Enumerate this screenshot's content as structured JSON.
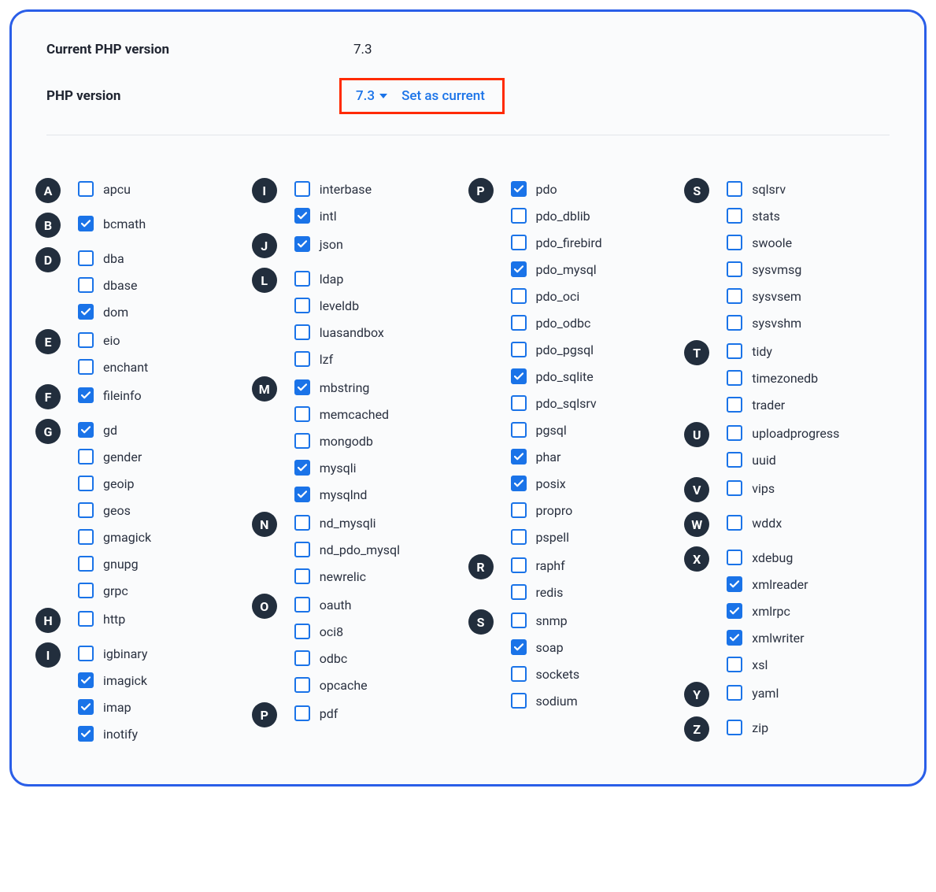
{
  "header": {
    "current_label": "Current PHP version",
    "current_value": "7.3",
    "version_label": "PHP version",
    "version_selected": "7.3",
    "set_as_current": "Set as current"
  },
  "columns": [
    [
      {
        "letter": "A",
        "items": [
          {
            "name": "apcu",
            "checked": false
          }
        ]
      },
      {
        "letter": "B",
        "items": [
          {
            "name": "bcmath",
            "checked": true
          }
        ]
      },
      {
        "letter": "D",
        "items": [
          {
            "name": "dba",
            "checked": false
          },
          {
            "name": "dbase",
            "checked": false
          },
          {
            "name": "dom",
            "checked": true
          }
        ]
      },
      {
        "letter": "E",
        "items": [
          {
            "name": "eio",
            "checked": false
          },
          {
            "name": "enchant",
            "checked": false
          }
        ]
      },
      {
        "letter": "F",
        "items": [
          {
            "name": "fileinfo",
            "checked": true
          }
        ]
      },
      {
        "letter": "G",
        "items": [
          {
            "name": "gd",
            "checked": true
          },
          {
            "name": "gender",
            "checked": false
          },
          {
            "name": "geoip",
            "checked": false
          },
          {
            "name": "geos",
            "checked": false
          },
          {
            "name": "gmagick",
            "checked": false
          },
          {
            "name": "gnupg",
            "checked": false
          },
          {
            "name": "grpc",
            "checked": false
          }
        ]
      },
      {
        "letter": "H",
        "items": [
          {
            "name": "http",
            "checked": false
          }
        ]
      },
      {
        "letter": "I",
        "items": [
          {
            "name": "igbinary",
            "checked": false
          },
          {
            "name": "imagick",
            "checked": true
          },
          {
            "name": "imap",
            "checked": true
          },
          {
            "name": "inotify",
            "checked": true
          }
        ]
      }
    ],
    [
      {
        "letter": "I",
        "items": [
          {
            "name": "interbase",
            "checked": false
          },
          {
            "name": "intl",
            "checked": true
          }
        ]
      },
      {
        "letter": "J",
        "items": [
          {
            "name": "json",
            "checked": true
          }
        ]
      },
      {
        "letter": "L",
        "items": [
          {
            "name": "ldap",
            "checked": false
          },
          {
            "name": "leveldb",
            "checked": false
          },
          {
            "name": "luasandbox",
            "checked": false
          },
          {
            "name": "lzf",
            "checked": false
          }
        ]
      },
      {
        "letter": "M",
        "items": [
          {
            "name": "mbstring",
            "checked": true
          },
          {
            "name": "memcached",
            "checked": false
          },
          {
            "name": "mongodb",
            "checked": false
          },
          {
            "name": "mysqli",
            "checked": true
          },
          {
            "name": "mysqlnd",
            "checked": true
          }
        ]
      },
      {
        "letter": "N",
        "items": [
          {
            "name": "nd_mysqli",
            "checked": false
          },
          {
            "name": "nd_pdo_mysql",
            "checked": false
          },
          {
            "name": "newrelic",
            "checked": false
          }
        ]
      },
      {
        "letter": "O",
        "items": [
          {
            "name": "oauth",
            "checked": false
          },
          {
            "name": "oci8",
            "checked": false
          },
          {
            "name": "odbc",
            "checked": false
          },
          {
            "name": "opcache",
            "checked": false
          }
        ]
      },
      {
        "letter": "P",
        "items": [
          {
            "name": "pdf",
            "checked": false
          }
        ]
      }
    ],
    [
      {
        "letter": "P",
        "items": [
          {
            "name": "pdo",
            "checked": true
          },
          {
            "name": "pdo_dblib",
            "checked": false
          },
          {
            "name": "pdo_firebird",
            "checked": false
          },
          {
            "name": "pdo_mysql",
            "checked": true
          },
          {
            "name": "pdo_oci",
            "checked": false
          },
          {
            "name": "pdo_odbc",
            "checked": false
          },
          {
            "name": "pdo_pgsql",
            "checked": false
          },
          {
            "name": "pdo_sqlite",
            "checked": true
          },
          {
            "name": "pdo_sqlsrv",
            "checked": false
          },
          {
            "name": "pgsql",
            "checked": false
          },
          {
            "name": "phar",
            "checked": true
          },
          {
            "name": "posix",
            "checked": true
          },
          {
            "name": "propro",
            "checked": false
          },
          {
            "name": "pspell",
            "checked": false
          }
        ]
      },
      {
        "letter": "R",
        "items": [
          {
            "name": "raphf",
            "checked": false
          },
          {
            "name": "redis",
            "checked": false
          }
        ]
      },
      {
        "letter": "S",
        "items": [
          {
            "name": "snmp",
            "checked": false
          },
          {
            "name": "soap",
            "checked": true
          },
          {
            "name": "sockets",
            "checked": false
          },
          {
            "name": "sodium",
            "checked": false
          }
        ]
      }
    ],
    [
      {
        "letter": "S",
        "items": [
          {
            "name": "sqlsrv",
            "checked": false
          },
          {
            "name": "stats",
            "checked": false
          },
          {
            "name": "swoole",
            "checked": false
          },
          {
            "name": "sysvmsg",
            "checked": false
          },
          {
            "name": "sysvsem",
            "checked": false
          },
          {
            "name": "sysvshm",
            "checked": false
          }
        ]
      },
      {
        "letter": "T",
        "items": [
          {
            "name": "tidy",
            "checked": false
          },
          {
            "name": "timezonedb",
            "checked": false
          },
          {
            "name": "trader",
            "checked": false
          }
        ]
      },
      {
        "letter": "U",
        "items": [
          {
            "name": "uploadprogress",
            "checked": false
          },
          {
            "name": "uuid",
            "checked": false
          }
        ]
      },
      {
        "letter": "V",
        "items": [
          {
            "name": "vips",
            "checked": false
          }
        ]
      },
      {
        "letter": "W",
        "items": [
          {
            "name": "wddx",
            "checked": false
          }
        ]
      },
      {
        "letter": "X",
        "items": [
          {
            "name": "xdebug",
            "checked": false
          },
          {
            "name": "xmlreader",
            "checked": true
          },
          {
            "name": "xmlrpc",
            "checked": true
          },
          {
            "name": "xmlwriter",
            "checked": true
          },
          {
            "name": "xsl",
            "checked": false
          }
        ]
      },
      {
        "letter": "Y",
        "items": [
          {
            "name": "yaml",
            "checked": false
          }
        ]
      },
      {
        "letter": "Z",
        "items": [
          {
            "name": "zip",
            "checked": false
          }
        ]
      }
    ]
  ]
}
